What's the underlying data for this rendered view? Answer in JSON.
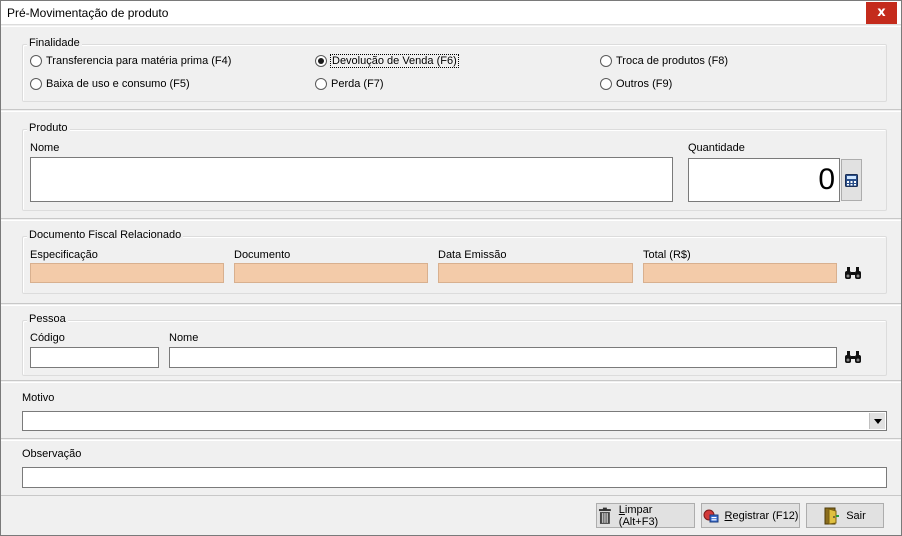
{
  "window": {
    "title": "Pré-Movimentação de produto",
    "close_glyph": "x"
  },
  "finalidade": {
    "legend": "Finalidade",
    "options": [
      {
        "label": "Transferencia para matéria prima (F4)",
        "checked": false
      },
      {
        "label": "Devolução de Venda (F6)",
        "checked": true
      },
      {
        "label": "Troca de produtos (F8)",
        "checked": false
      },
      {
        "label": "Baixa de uso e consumo (F5)",
        "checked": false
      },
      {
        "label": "Perda (F7)",
        "checked": false
      },
      {
        "label": "Outros (F9)",
        "checked": false
      }
    ]
  },
  "produto": {
    "legend": "Produto",
    "nome_label": "Nome",
    "nome_value": "",
    "quantidade_label": "Quantidade",
    "quantidade_value": "0",
    "calc_icon": "calculator-icon"
  },
  "documento": {
    "legend": "Documento Fiscal Relacionado",
    "especificacao_label": "Especificação",
    "documento_label": "Documento",
    "data_emissao_label": "Data Emissão",
    "total_label": "Total (R$)",
    "readonly_color": "#f3cba9",
    "search_icon": "binoculars-icon"
  },
  "pessoa": {
    "legend": "Pessoa",
    "codigo_label": "Código",
    "nome_label": "Nome",
    "codigo_value": "",
    "nome_value": "",
    "search_icon": "binoculars-icon"
  },
  "motivo": {
    "label": "Motivo",
    "selected": ""
  },
  "observacao": {
    "label": "Observação",
    "value": ""
  },
  "buttons": {
    "limpar": {
      "hotkey_letter": "L",
      "label_rest": "impar (Alt+F3)",
      "icon": "trash-icon"
    },
    "registrar": {
      "hotkey_letter": "R",
      "label_rest": "egistrar (F12)",
      "icon": "register-icon"
    },
    "sair": {
      "label": "Sair",
      "icon": "exit-door-icon"
    }
  }
}
